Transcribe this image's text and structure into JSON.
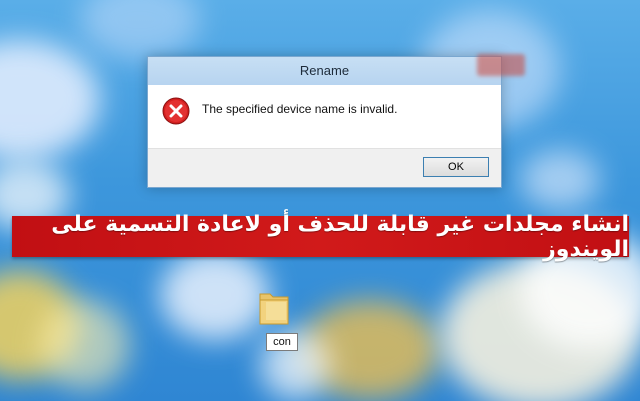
{
  "dialog": {
    "title": "Rename",
    "message": "The specified device name is invalid.",
    "ok_label": "OK",
    "icon": "error-icon"
  },
  "banner": {
    "text": "انشاء مجلدات غير قابلة للحذف أو لاعادة التسمية على الويندوز",
    "color": "#c10f13"
  },
  "desktop": {
    "folder_label": "con",
    "folder_icon": "folder-icon"
  }
}
